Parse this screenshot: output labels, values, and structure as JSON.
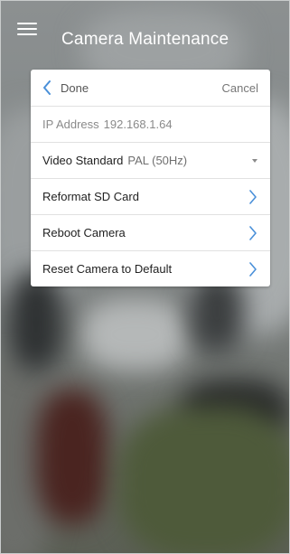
{
  "header": {
    "title": "Camera Maintenance",
    "menu_icon": "hamburger-menu-icon"
  },
  "card": {
    "back_label": "Done",
    "cancel_label": "Cancel",
    "ip_label": "IP Address",
    "ip_value": "192.168.1.64",
    "video_label": "Video Standard",
    "video_value": "PAL (50Hz)",
    "actions": [
      {
        "label": "Reformat SD Card"
      },
      {
        "label": "Reboot Camera"
      },
      {
        "label": "Reset Camera to Default"
      }
    ]
  },
  "colors": {
    "accent": "#4a90d9",
    "card_bg": "#ffffff",
    "title": "#ffffff"
  }
}
